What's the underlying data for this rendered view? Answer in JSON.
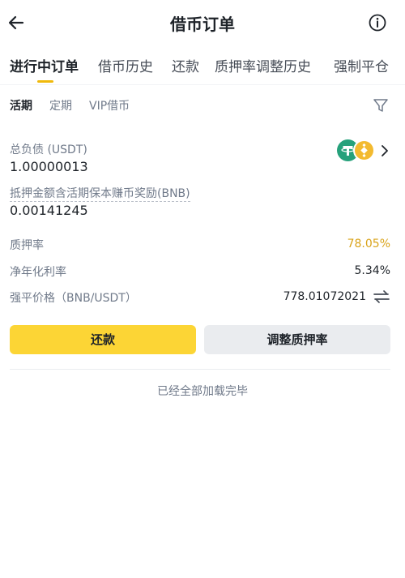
{
  "header": {
    "title": "借币订单"
  },
  "tabs": [
    {
      "label": "进行中订单"
    },
    {
      "label": "借币历史"
    },
    {
      "label": "还款"
    },
    {
      "label": "质押率调整历史"
    },
    {
      "label": "强制平仓"
    }
  ],
  "subtabs": [
    {
      "label": "活期"
    },
    {
      "label": "定期"
    },
    {
      "label": "VIP借币"
    }
  ],
  "order": {
    "debt_label": "总负债 (USDT)",
    "debt_value": "1.00000013",
    "collateral_label": "抵押金额含活期保本赚币奖励(BNB)",
    "collateral_value": "0.00141245",
    "ltv_label": "质押率",
    "ltv_value": "78.05%",
    "apr_label": "净年化利率",
    "apr_value": "5.34%",
    "liq_label": "强平价格（BNB/USDT）",
    "liq_value": "778.01072021",
    "coins": [
      "USDT",
      "BNB"
    ]
  },
  "buttons": {
    "repay": "还款",
    "adjust": "调整质押率"
  },
  "footer": {
    "text": "已经全部加载完毕"
  },
  "colors": {
    "accent": "#fcd535",
    "ltv_warning": "#d9a31a",
    "usdt": "#26a17b",
    "bnb": "#f3ba2f"
  },
  "icons": {
    "back": "arrow-left-icon",
    "info": "info-icon",
    "filter": "filter-icon",
    "chevron": "chevron-right-icon",
    "swap": "swap-arrows-icon"
  }
}
